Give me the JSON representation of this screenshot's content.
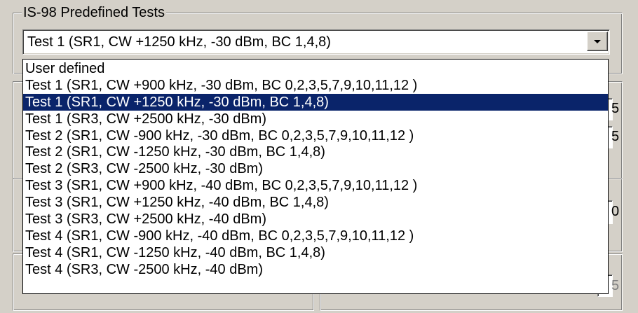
{
  "group": {
    "title": "IS-98 Predefined Tests"
  },
  "combo": {
    "selected": "Test 1 (SR1, CW +1250 kHz, -30 dBm, BC 1,4,8)"
  },
  "dropdown": {
    "selected_index": 2,
    "options": [
      "User defined",
      "Test 1 (SR1, CW +900 kHz, -30 dBm, BC 0,2,3,5,7,9,10,11,12 )",
      "Test 1 (SR1, CW +1250 kHz, -30 dBm, BC 1,4,8)",
      "Test 1 (SR3, CW +2500 kHz, -30 dBm)",
      "Test 2 (SR1, CW -900 kHz, -30 dBm, BC 0,2,3,5,7,9,10,11,12 )",
      "Test 2 (SR1, CW -1250 kHz, -30 dBm, BC 1,4,8)",
      "Test 2 (SR3, CW -2500 kHz, -30 dBm)",
      "Test 3 (SR1, CW +900 kHz, -40 dBm, BC 0,2,3,5,7,9,10,11,12 )",
      "Test 3 (SR1, CW +1250 kHz, -40 dBm, BC 1,4,8)",
      "Test 3 (SR3, CW +2500 kHz, -40 dBm)",
      "Test 4 (SR1, CW -900 kHz, -40 dBm, BC 0,2,3,5,7,9,10,11,12 )",
      "Test 4 (SR1, CW -1250 kHz, -40 dBm, BC 1,4,8)",
      "Test 4 (SR3, CW -2500 kHz, -40 dBm)"
    ]
  },
  "background_fields": {
    "field1_char": "5",
    "field2_char": "5",
    "field3_char": "0",
    "field4_char": "5"
  },
  "colors": {
    "face": "#d4d0c8",
    "highlight": "#0a246a",
    "highlight_text": "#ffffff"
  },
  "icons": {
    "combo_arrow": "chevron-down-icon"
  }
}
